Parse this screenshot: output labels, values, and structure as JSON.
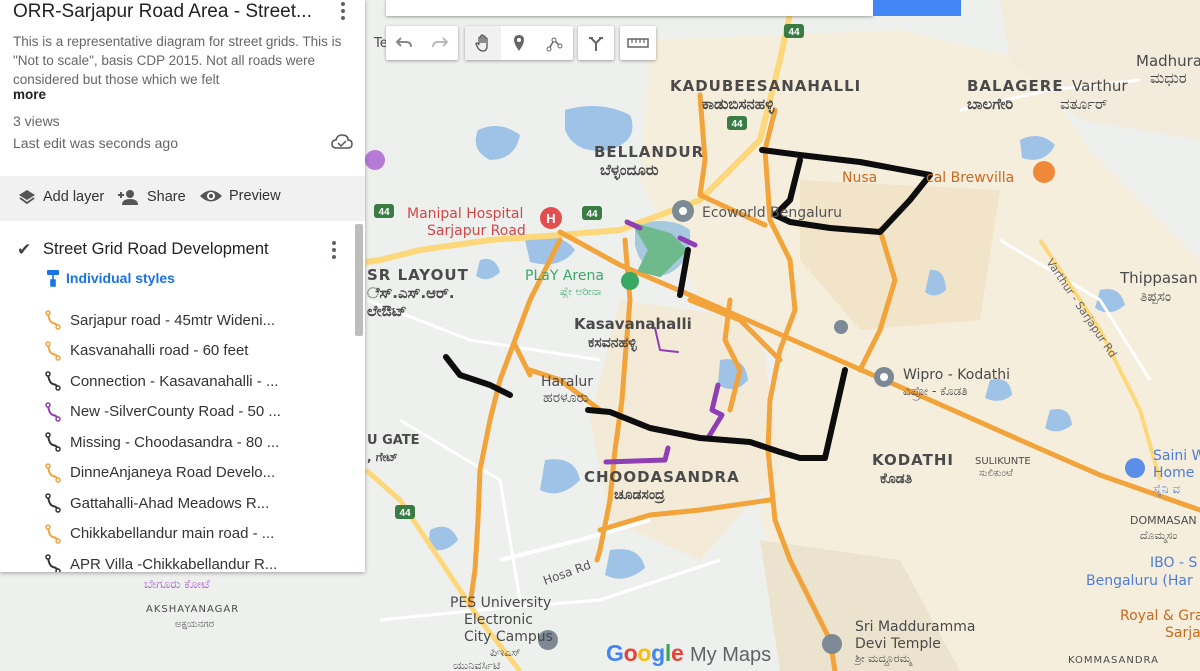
{
  "panel": {
    "title": "ORR-Sarjapur Road Area - Street...",
    "description": "This is a representative diagram for street grids. This is \"Not to scale\", basis CDP 2015. Not all roads were considered but those which we felt",
    "more_label": "more",
    "views": "3 views",
    "last_edit": "Last edit was seconds ago",
    "actions": {
      "add_layer": "Add layer",
      "share": "Share",
      "preview": "Preview"
    },
    "layer": {
      "title": "Street Grid Road Development",
      "styles_label": "Individual styles",
      "features": [
        {
          "label": "Sarjapur road - 45mtr Wideni...",
          "color": "#f2a33a"
        },
        {
          "label": "Kasvanahalli road - 60 feet",
          "color": "#f2a33a"
        },
        {
          "label": "Connection - Kasavanahalli - ...",
          "color": "#333333"
        },
        {
          "label": "New -SilverCounty Road - 50 ...",
          "color": "#8e3fb5"
        },
        {
          "label": "Missing - Choodasandra - 80 ...",
          "color": "#333333"
        },
        {
          "label": "DinneAnjaneya Road Develo...",
          "color": "#f2a33a"
        },
        {
          "label": "Gattahalli-Ahad Meadows R...",
          "color": "#333333"
        },
        {
          "label": "Chikkabellandur main road - ...",
          "color": "#f2a33a"
        },
        {
          "label": "APR Villa -Chikkabellandur R...",
          "color": "#333333"
        }
      ]
    }
  },
  "toolbar": {
    "buttons": [
      "undo-icon",
      "redo-icon",
      "hand-icon",
      "marker-icon",
      "draw-line-icon",
      "directions-icon",
      "ruler-icon"
    ]
  },
  "map": {
    "labels": {
      "kadubeesanahalli": "KADUBEESANAHALLI",
      "kadubeesanahalli_kn": "ಕಾಡುಬಿಸನಹಳ್ಳಿ",
      "balagere": "BALAGERE",
      "balagere_kn": "ಬಾಲಗೇರಿ",
      "varthur": "Varthur",
      "varthur_kn": "ವರ್ತೂರ್",
      "madhura": "Madhura",
      "madhura_kn": "ಮಧುರ",
      "bellandur": "BELLANDUR",
      "bellandur_kn": "ಬೆಳ್ಳಂದೂರು",
      "nusa": "Nusa",
      "brewvilla": "cal Brewvilla",
      "ecoworld": "Ecoworld Bengaluru",
      "manipal1": "Manipal Hospital",
      "manipal2": "Sarjapur Road",
      "play_arena": "PLaY Arena",
      "play_arena_kn": "ಪ್ಲೇ ಅರೀನಾ",
      "hsr1": "SR LAYOUT",
      "hsr2": "ೆಸ್.ಎಸ್.ಆರ್.",
      "hsr3": "ಲೇಔಟ್",
      "kasavanahalli": "Kasavanahalli",
      "kasavanahalli_kn": "ಕಸವನಹಳ್ಳಿ",
      "haralur": "Haralur",
      "haralur_kn": "ಹರಳೂರು",
      "thippasandra": "Thippasan",
      "thippasandra_kn": "ತಿಪ್ಪಸಂ",
      "varthur_sarjapur": "Varthur - Sarjapur Rd",
      "wipro": "Wipro - Kodathi",
      "wipro_kn": "ವಿಪ್ರೋ - ಕೊಡತಿ",
      "kodathi": "KODATHI",
      "kodathi_kn": "ಕೊಡತಿ",
      "sulikunte": "SULIKUNTE",
      "sulikunte_kn": "ಸುಲಿಕುಂಟೆ",
      "saini1": "Saini W",
      "saini2": "Home",
      "saini3": "ಸೈನಿ ವ",
      "u_gate": "U GATE",
      "u_gate_kn": ", ಗೇಟ್",
      "choodasandra": "CHOODASANDRA",
      "choodasandra_kn": "ಚೂಡಸಂದ್ರ",
      "dommasandra": "DOMMASAN",
      "dommasandra_kn": "ದೊಮ್ಮಸಂ",
      "ibo1": "IBO - S",
      "ibo2": "Bengaluru (Har",
      "hosa_rd": "Hosa Rd",
      "kote_kn": "ಬೇಗೂರು ಕೋಟೆ",
      "akshayanagar": "AKSHAYANAGAR",
      "akshayanagar_kn": "ಅಕ್ಷಯನಗರ",
      "pes1": "PES University",
      "pes2": "Electronic",
      "pes3": "City Campus",
      "pes4": "ಪಿಇಎಸ್",
      "pes5": "ಯುನಿವರ್ಸಿಟಿ",
      "temple1": "Sri Madduramma",
      "temple2": "Devi Temple",
      "temple3": "ಶ್ರೀ ಮದ್ದೂರಮ್ಮ",
      "temple4": "ದೇವಿ ದೇವಸ್ಥಾನ",
      "royal1": "Royal & Gra",
      "royal2": "Sarja",
      "kommasandra": "KOMMASANDRA",
      "te": "Te",
      "hwy_44": "44"
    },
    "logo_google": "Google",
    "logo_mymaps": "My Maps"
  },
  "colors": {
    "orange_road": "#f2a33a",
    "black_road": "#0d0d0d",
    "purple_road": "#8e3fb5",
    "green_road": "#6fba8d",
    "water": "#9fc3e7",
    "land": "#eef0ee",
    "urban": "#f7efe0",
    "search_blue": "#4285f4"
  }
}
